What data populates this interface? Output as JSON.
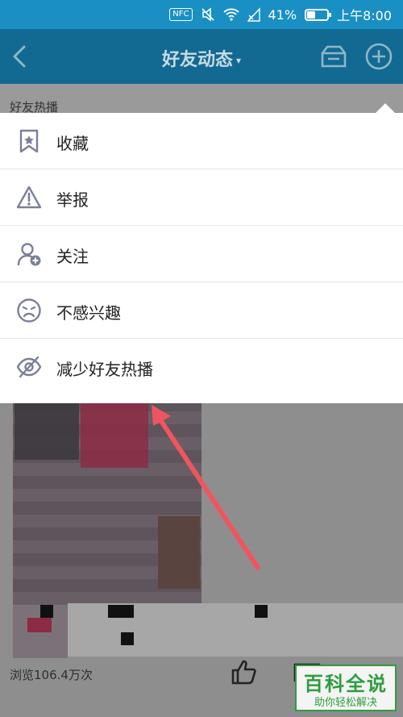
{
  "status_bar": {
    "nfc": "NFC",
    "battery_text": "41%",
    "battery_level": 0.41,
    "time": "上午8:00"
  },
  "nav": {
    "title": "好友动态",
    "caret": "▾"
  },
  "section": {
    "label": "好友热播"
  },
  "menu": {
    "items": [
      {
        "label": "收藏",
        "icon": "bookmark-star-icon"
      },
      {
        "label": "举报",
        "icon": "warning-icon"
      },
      {
        "label": "关注",
        "icon": "add-user-icon"
      },
      {
        "label": "不感兴趣",
        "icon": "sad-face-icon"
      },
      {
        "label": "减少好友热播",
        "icon": "eye-off-icon"
      }
    ]
  },
  "feed": {
    "views": "浏览106.4万次"
  },
  "watermark": {
    "title": "百科全说",
    "subtitle": "助你轻松解决"
  },
  "colors": {
    "status_bar": "#1a8fc4",
    "nav_dimmed": "#126a92",
    "annotation_arrow": "#f0555f",
    "icon_gray": "#7b7f99",
    "watermark_green": "#2e9d3f"
  }
}
